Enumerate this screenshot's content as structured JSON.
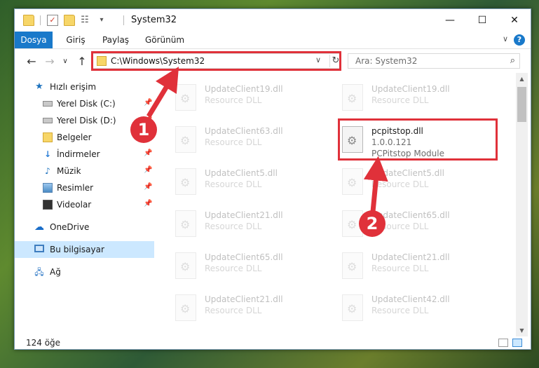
{
  "window": {
    "title": "System32"
  },
  "titlebar": {
    "minimize": "—",
    "maximize": "☐",
    "close": "✕"
  },
  "ribbon": {
    "tabs": [
      "Dosya",
      "Giriş",
      "Paylaş",
      "Görünüm"
    ],
    "active_tab": "Dosya",
    "help": "?",
    "collapse": "∨"
  },
  "address": {
    "path": "C:\\Windows\\System32",
    "back": "←",
    "forward": "→",
    "recent": "∨",
    "up": "↑",
    "dropdown": "∨",
    "refresh": "↻"
  },
  "search": {
    "placeholder": "Ara: System32",
    "icon": "⌕"
  },
  "sidebar": {
    "items": [
      {
        "label": "Hızlı erişim"
      },
      {
        "label": "Yerel Disk (C:)"
      },
      {
        "label": "Yerel Disk (D:)"
      },
      {
        "label": "Belgeler"
      },
      {
        "label": "İndirmeler"
      },
      {
        "label": "Müzik"
      },
      {
        "label": "Resimler"
      },
      {
        "label": "Videolar"
      },
      {
        "label": "OneDrive"
      },
      {
        "label": "Bu bilgisayar"
      },
      {
        "label": "Ağ"
      }
    ],
    "selected": "Bu bilgisayar"
  },
  "files": [
    {
      "name": "UpdateClient19.dll",
      "desc": "Resource DLL"
    },
    {
      "name": "UpdateClient19.dll",
      "desc": "Resource DLL"
    },
    {
      "name": "UpdateClient63.dll",
      "desc": "Resource DLL"
    },
    {
      "name": "pcpitstop.dll",
      "version": "1.0.0.121",
      "desc": "PCPitstop Module"
    },
    {
      "name": "UpdateClient5.dll",
      "desc": "Resource DLL"
    },
    {
      "name": "UpdateClient5.dll",
      "desc": "Resource DLL"
    },
    {
      "name": "UpdateClient21.dll",
      "desc": "Resource DLL"
    },
    {
      "name": "UpdateClient65.dll",
      "desc": "Resource DLL"
    },
    {
      "name": "UpdateClient65.dll",
      "desc": "Resource DLL"
    },
    {
      "name": "UpdateClient21.dll",
      "desc": "Resource DLL"
    },
    {
      "name": "UpdateClient21.dll",
      "desc": "Resource DLL"
    },
    {
      "name": "UpdateClient42.dll",
      "desc": "Resource DLL"
    }
  ],
  "status": {
    "count": "124 öğe"
  },
  "annotations": {
    "step1": "1",
    "step2": "2",
    "accent": "#e0313a"
  }
}
